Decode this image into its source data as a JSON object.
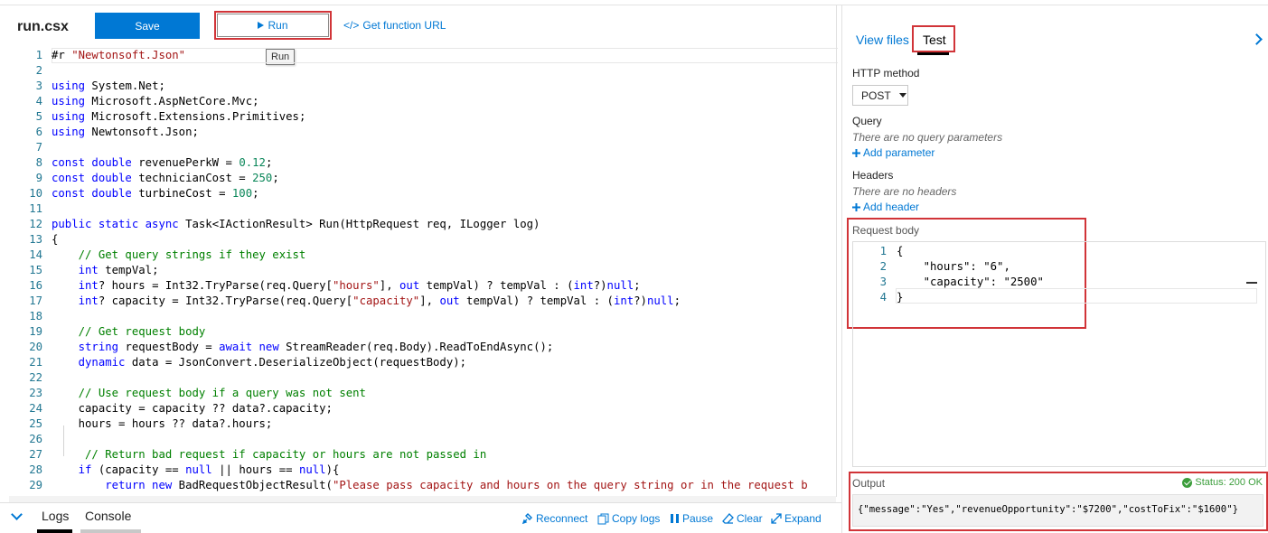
{
  "editor": {
    "file_name": "run.csx",
    "save_label": "Save",
    "run_label": "Run",
    "get_url_icon": "</>",
    "get_url_label": "Get function URL",
    "tooltip": "Run",
    "code_lines": [
      {
        "n": "1",
        "segs": [
          {
            "t": "#r ",
            "c": ""
          },
          {
            "t": "\"Newtonsoft.Json\"",
            "c": "s"
          }
        ]
      },
      {
        "n": "2",
        "segs": []
      },
      {
        "n": "3",
        "segs": [
          {
            "t": "using",
            "c": "k"
          },
          {
            "t": " System.Net;",
            "c": ""
          }
        ]
      },
      {
        "n": "4",
        "segs": [
          {
            "t": "using",
            "c": "k"
          },
          {
            "t": " Microsoft.AspNetCore.Mvc;",
            "c": ""
          }
        ]
      },
      {
        "n": "5",
        "segs": [
          {
            "t": "using",
            "c": "k"
          },
          {
            "t": " Microsoft.Extensions.Primitives;",
            "c": ""
          }
        ]
      },
      {
        "n": "6",
        "segs": [
          {
            "t": "using",
            "c": "k"
          },
          {
            "t": " Newtonsoft.Json;",
            "c": ""
          }
        ]
      },
      {
        "n": "7",
        "segs": []
      },
      {
        "n": "8",
        "segs": [
          {
            "t": "const double",
            "c": "k"
          },
          {
            "t": " revenuePerkW = ",
            "c": ""
          },
          {
            "t": "0.12",
            "c": "n"
          },
          {
            "t": ";",
            "c": ""
          }
        ]
      },
      {
        "n": "9",
        "segs": [
          {
            "t": "const double",
            "c": "k"
          },
          {
            "t": " technicianCost = ",
            "c": ""
          },
          {
            "t": "250",
            "c": "n"
          },
          {
            "t": ";",
            "c": ""
          }
        ]
      },
      {
        "n": "10",
        "segs": [
          {
            "t": "const double",
            "c": "k"
          },
          {
            "t": " turbineCost = ",
            "c": ""
          },
          {
            "t": "100",
            "c": "n"
          },
          {
            "t": ";",
            "c": ""
          }
        ]
      },
      {
        "n": "11",
        "segs": []
      },
      {
        "n": "12",
        "segs": [
          {
            "t": "public static async",
            "c": "k"
          },
          {
            "t": " Task<IActionResult> Run(HttpRequest req, ILogger log)",
            "c": ""
          }
        ]
      },
      {
        "n": "13",
        "segs": [
          {
            "t": "{",
            "c": ""
          }
        ]
      },
      {
        "n": "14",
        "segs": [
          {
            "t": "    // Get query strings if they exist",
            "c": "c"
          }
        ]
      },
      {
        "n": "15",
        "segs": [
          {
            "t": "    ",
            "c": ""
          },
          {
            "t": "int",
            "c": "k"
          },
          {
            "t": " tempVal;",
            "c": ""
          }
        ]
      },
      {
        "n": "16",
        "segs": [
          {
            "t": "    ",
            "c": ""
          },
          {
            "t": "int",
            "c": "k"
          },
          {
            "t": "? hours = Int32.TryParse(req.Query[",
            "c": ""
          },
          {
            "t": "\"hours\"",
            "c": "s"
          },
          {
            "t": "], ",
            "c": ""
          },
          {
            "t": "out",
            "c": "k"
          },
          {
            "t": " tempVal) ? tempVal : (",
            "c": ""
          },
          {
            "t": "int",
            "c": "k"
          },
          {
            "t": "?)",
            "c": ""
          },
          {
            "t": "null",
            "c": "k"
          },
          {
            "t": ";",
            "c": ""
          }
        ]
      },
      {
        "n": "17",
        "segs": [
          {
            "t": "    ",
            "c": ""
          },
          {
            "t": "int",
            "c": "k"
          },
          {
            "t": "? capacity = Int32.TryParse(req.Query[",
            "c": ""
          },
          {
            "t": "\"capacity\"",
            "c": "s"
          },
          {
            "t": "], ",
            "c": ""
          },
          {
            "t": "out",
            "c": "k"
          },
          {
            "t": " tempVal) ? tempVal : (",
            "c": ""
          },
          {
            "t": "int",
            "c": "k"
          },
          {
            "t": "?)",
            "c": ""
          },
          {
            "t": "null",
            "c": "k"
          },
          {
            "t": ";",
            "c": ""
          }
        ]
      },
      {
        "n": "18",
        "segs": []
      },
      {
        "n": "19",
        "segs": [
          {
            "t": "    // Get request body",
            "c": "c"
          }
        ]
      },
      {
        "n": "20",
        "segs": [
          {
            "t": "    ",
            "c": ""
          },
          {
            "t": "string",
            "c": "k"
          },
          {
            "t": " requestBody = ",
            "c": ""
          },
          {
            "t": "await new",
            "c": "k"
          },
          {
            "t": " StreamReader(req.Body).ReadToEndAsync();",
            "c": ""
          }
        ]
      },
      {
        "n": "21",
        "segs": [
          {
            "t": "    ",
            "c": ""
          },
          {
            "t": "dynamic",
            "c": "k"
          },
          {
            "t": " data = JsonConvert.DeserializeObject(requestBody);",
            "c": ""
          }
        ]
      },
      {
        "n": "22",
        "segs": []
      },
      {
        "n": "23",
        "segs": [
          {
            "t": "    // Use request body if a query was not sent",
            "c": "c"
          }
        ]
      },
      {
        "n": "24",
        "segs": [
          {
            "t": "    capacity = capacity ?? data?.capacity;",
            "c": ""
          }
        ]
      },
      {
        "n": "25",
        "segs": [
          {
            "t": "    hours = hours ?? data?.hours;",
            "c": ""
          }
        ]
      },
      {
        "n": "26",
        "segs": []
      },
      {
        "n": "27",
        "segs": [
          {
            "t": "     // Return bad request if capacity or hours are not passed in",
            "c": "c"
          }
        ]
      },
      {
        "n": "28",
        "segs": [
          {
            "t": "    ",
            "c": ""
          },
          {
            "t": "if",
            "c": "k"
          },
          {
            "t": " (capacity == ",
            "c": ""
          },
          {
            "t": "null",
            "c": "k"
          },
          {
            "t": " || hours == ",
            "c": ""
          },
          {
            "t": "null",
            "c": "k"
          },
          {
            "t": "){",
            "c": ""
          }
        ]
      },
      {
        "n": "29",
        "segs": [
          {
            "t": "        ",
            "c": ""
          },
          {
            "t": "return new",
            "c": "k"
          },
          {
            "t": " BadRequestObjectResult(",
            "c": ""
          },
          {
            "t": "\"Please pass capacity and hours on the query string or in the request b",
            "c": "s"
          }
        ]
      }
    ]
  },
  "bottom": {
    "logs_label": "Logs",
    "console_label": "Console",
    "reconnect_label": "Reconnect",
    "copy_logs_label": "Copy logs",
    "pause_label": "Pause",
    "clear_label": "Clear",
    "expand_label": "Expand"
  },
  "test": {
    "view_files_label": "View files",
    "test_label": "Test",
    "http_method_label": "HTTP method",
    "http_method_value": "POST",
    "query_label": "Query",
    "query_empty": "There are no query parameters",
    "add_parameter_label": "Add parameter",
    "headers_label": "Headers",
    "headers_empty": "There are no headers",
    "add_header_label": "Add header",
    "request_body_label": "Request body",
    "request_body_lines": [
      {
        "n": "1",
        "text": "{"
      },
      {
        "n": "2",
        "text": "    \"hours\": \"6\","
      },
      {
        "n": "3",
        "text": "    \"capacity\": \"2500\""
      },
      {
        "n": "4",
        "text": "}"
      }
    ],
    "output_label": "Output",
    "status_text": "Status: 200 OK",
    "output_text": "{\"message\":\"Yes\",\"revenueOpportunity\":\"$7200\",\"costToFix\":\"$1600\"}"
  },
  "colors": {
    "accent": "#0078d4",
    "highlight_red": "#d13438",
    "status_green": "#3c9e3c"
  },
  "icons": [
    "play-icon",
    "chevron-down-icon",
    "chevron-right-icon",
    "plus-icon",
    "check-circle-icon",
    "reconnect-icon",
    "copy-icon",
    "pause-icon",
    "clear-icon",
    "expand-icon",
    "code-icon",
    "caret-down-icon"
  ]
}
